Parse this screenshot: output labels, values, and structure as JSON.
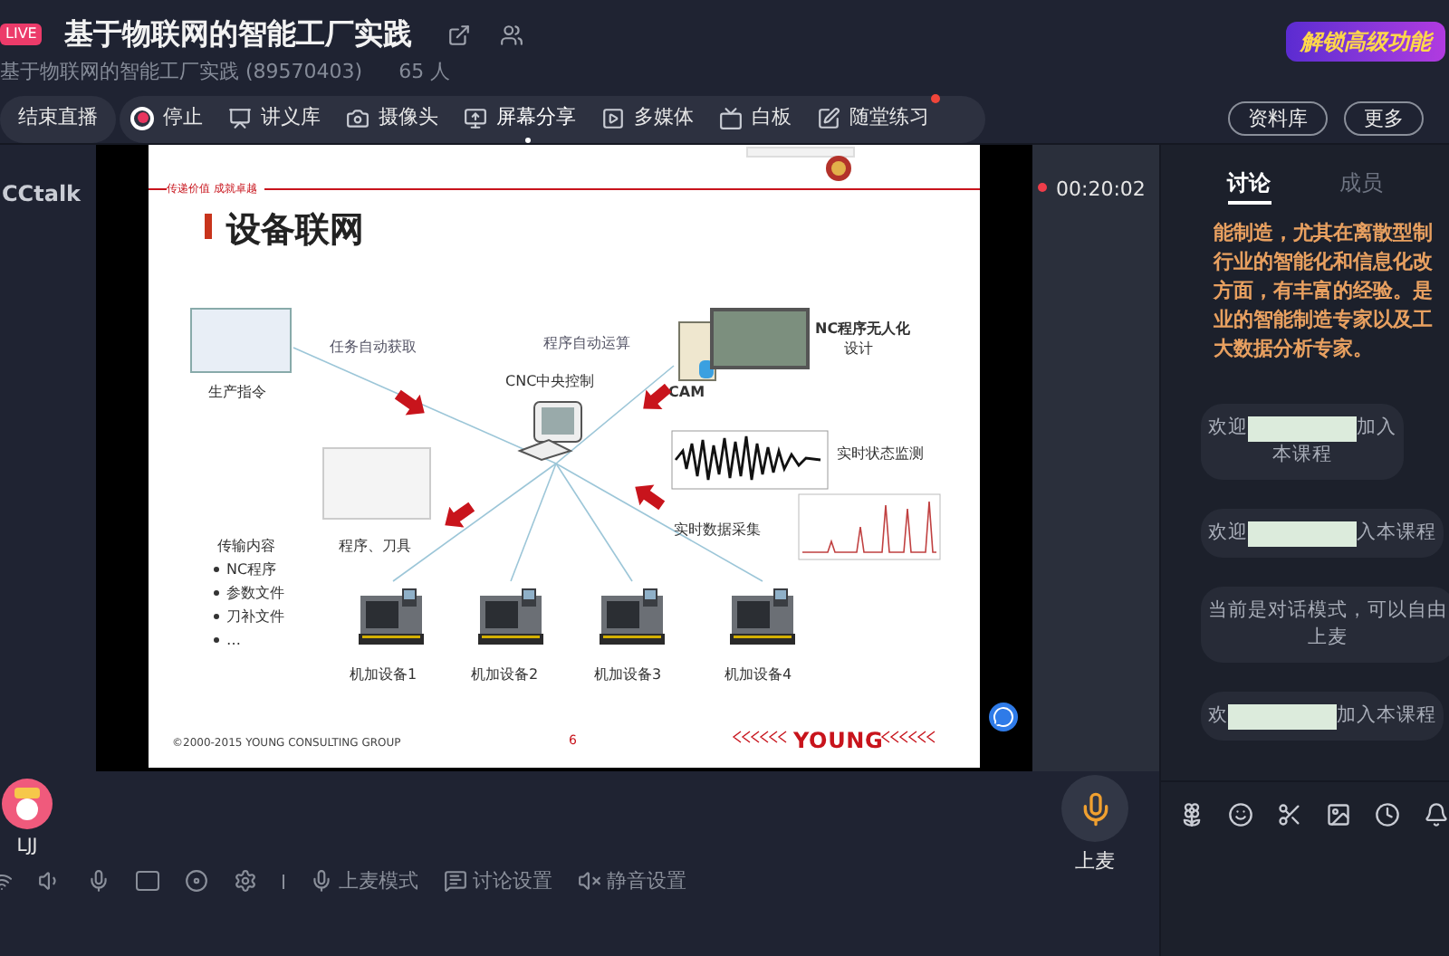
{
  "header": {
    "live_badge": "LIVE",
    "title": "基于物联网的智能工厂实践",
    "subtitle": "基于物联网的智能工厂实践 (89570403)",
    "member_count": "65 人",
    "upgrade": "解锁高级功能"
  },
  "toolbar": {
    "end_button": "结束直播",
    "items": [
      {
        "label": "停止",
        "selected": false,
        "notify": false
      },
      {
        "label": "讲义库",
        "selected": false,
        "notify": false
      },
      {
        "label": "摄像头",
        "selected": false,
        "notify": false
      },
      {
        "label": "屏幕分享",
        "selected": true,
        "notify": false
      },
      {
        "label": "多媒体",
        "selected": false,
        "notify": false
      },
      {
        "label": "白板",
        "selected": false,
        "notify": false
      },
      {
        "label": "随堂练习",
        "selected": false,
        "notify": true
      }
    ],
    "right_buttons": [
      "资料库",
      "更多"
    ]
  },
  "brand": "CCtalk",
  "timer": "00:20:02",
  "slide": {
    "tagline": "传递价值  成就卓越",
    "title": "设备联网",
    "order_label": "生产指令",
    "task_label": "任务自动获取",
    "cnc_label": "CNC中央控制",
    "program_label": "程序自动运算",
    "cam_label": "CAM",
    "nc_label": [
      "NC程序无人化",
      "设计"
    ],
    "monitor_label": "实时状态监测",
    "collect_label": "实时数据采集",
    "tools_label": "程序、刀具",
    "transfer": {
      "heading": "传输内容",
      "items": [
        "NC程序",
        "参数文件",
        "刀补文件",
        "…"
      ]
    },
    "machines": [
      "机加设备1",
      "机加设备2",
      "机加设备3",
      "机加设备4"
    ],
    "footer": {
      "copyright": "©2000-2015 YOUNG CONSULTING GROUP",
      "page": "6",
      "brand": "YOUNG"
    }
  },
  "chat": {
    "tabs": [
      {
        "label": "讨论",
        "selected": true
      },
      {
        "label": "成员",
        "selected": false
      }
    ],
    "intro_lines": [
      "能制造，尤其在离散型制",
      "行业的智能化和信息化改",
      "方面，有丰富的经验。是",
      "业的智能制造专家以及工",
      "大数据分析专家。"
    ],
    "messages": [
      {
        "kind": "welcome",
        "before": "欢迎",
        "after": "加入",
        "line2": "本课程"
      },
      {
        "kind": "welcome",
        "before": "欢迎",
        "after": "入本课程"
      },
      {
        "kind": "notice",
        "lines": [
          "当前是对话模式，可以自由",
          "上麦"
        ]
      },
      {
        "kind": "welcome",
        "before": "欢",
        "after": "加入本课程"
      }
    ]
  },
  "presenter": {
    "name": "LJJ"
  },
  "mic_button": {
    "label": "上麦"
  },
  "bottom_toolbar": [
    "上麦模式",
    "讨论设置",
    "静音设置"
  ]
}
